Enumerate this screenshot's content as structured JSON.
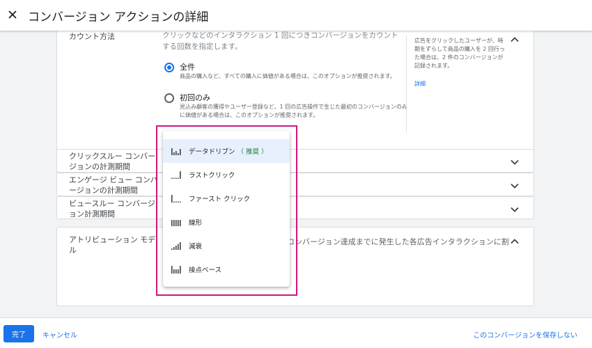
{
  "header": {
    "title": "コンバージョン アクションの詳細",
    "close_icon": "close-icon"
  },
  "count_section": {
    "label": "カウント方法",
    "description": "クリックなどのインタラクション 1 回につきコンバージョンをカウントする回数を指定します。",
    "options": [
      {
        "label": "全件",
        "description": "商品の購入など、すべての購入に価値がある場合は、このオプションが推奨されます。",
        "selected": true
      },
      {
        "label": "初回のみ",
        "description": "見込み顧客の獲得やユーザー登録など、1 回の広告操作で生じた最初のコンバージョンのみに価値がある場合は、このオプションが推奨されます。",
        "selected": false
      }
    ],
    "help_text": "広告をクリックしたユーザーが、時期をずらして商品の購入を 2 回行った場合は、2 件のコンバージョンが記録されます。",
    "help_link": "詳細"
  },
  "click_section": {
    "label": "クリックスルー コンバージョンの計測期間"
  },
  "engaged_section": {
    "label": "エンゲージ ビュー コンバージョンの計測期間"
  },
  "view_section": {
    "label": "ビュースルー コンバージョン計測期間"
  },
  "attribution_section": {
    "label": "アトリビューション モデル",
    "description": "コンバージョン達成までに発生した各広告インタラクションに割"
  },
  "attribution_dropdown": {
    "items": [
      {
        "label": "データドリブン",
        "recommended": "（ 推奨 ）",
        "icon": "data-driven-icon",
        "selected": true
      },
      {
        "label": "ラストクリック",
        "icon": "last-click-icon",
        "selected": false
      },
      {
        "label": "ファースト クリック",
        "icon": "first-click-icon",
        "selected": false
      },
      {
        "label": "線形",
        "icon": "linear-icon",
        "selected": false
      },
      {
        "label": "減衰",
        "icon": "time-decay-icon",
        "selected": false
      },
      {
        "label": "接点ベース",
        "icon": "position-based-icon",
        "selected": false
      }
    ]
  },
  "footer": {
    "done_label": "完了",
    "cancel_label": "キャンセル",
    "no_save_label": "このコンバージョンを保存しない"
  },
  "colors": {
    "accent": "#1a73e8",
    "highlight": "#d0157f",
    "recommended": "#188038"
  }
}
